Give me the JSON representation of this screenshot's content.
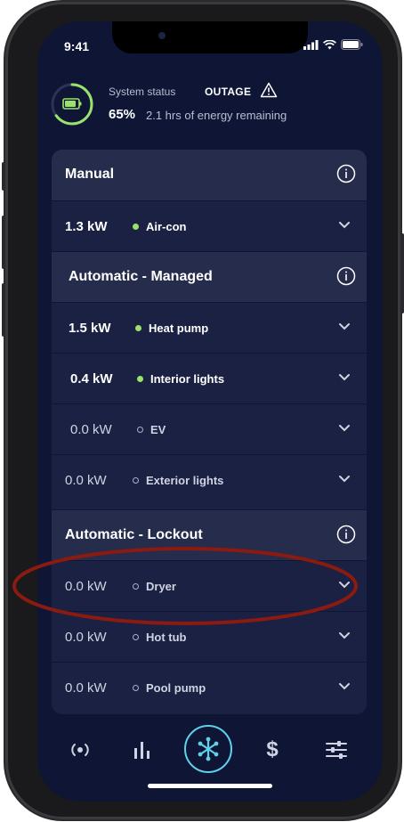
{
  "status_bar": {
    "time": "9:41"
  },
  "system_status": {
    "label": "System status",
    "state": "OUTAGE",
    "battery_percent": "65%",
    "remaining": "2.1 hrs of energy remaining",
    "battery_level": 0.65
  },
  "sections": [
    {
      "title": "Manual",
      "rows": [
        {
          "kw": "1.3 kW",
          "device": "Air-con",
          "active": true
        }
      ]
    },
    {
      "title": "Automatic - Managed",
      "rows": [
        {
          "kw": "1.5 kW",
          "device": "Heat pump",
          "active": true
        },
        {
          "kw": "0.4 kW",
          "device": "Interior lights",
          "active": true
        },
        {
          "kw": "0.0 kW",
          "device": "EV",
          "active": false
        },
        {
          "kw": "0.0 kW",
          "device": "Exterior lights",
          "active": false
        }
      ]
    },
    {
      "title": "Automatic - Lockout",
      "rows": [
        {
          "kw": "0.0 kW",
          "device": "Dryer",
          "active": false
        },
        {
          "kw": "0.0 kW",
          "device": "Hot tub",
          "active": false
        },
        {
          "kw": "0.0 kW",
          "device": "Pool pump",
          "active": false
        }
      ]
    }
  ],
  "nav": {
    "dollar": "$"
  },
  "colors": {
    "background": "#0e1535",
    "panel": "#1b2142",
    "section": "#262c4c",
    "active_dot": "#9be26a",
    "accent": "#5ed1e8",
    "highlight": "#8b1a10"
  }
}
